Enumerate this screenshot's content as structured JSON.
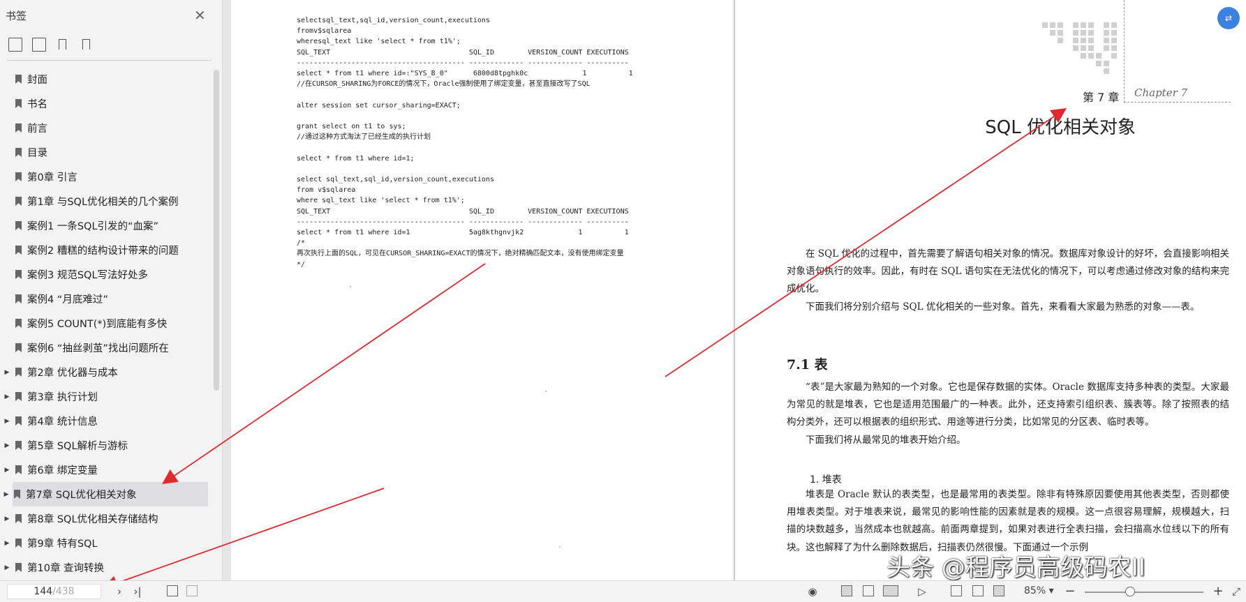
{
  "sidebar": {
    "title": "书签",
    "items": [
      {
        "label": "封面",
        "expandable": false
      },
      {
        "label": "书名",
        "expandable": false
      },
      {
        "label": "前言",
        "expandable": false
      },
      {
        "label": "目录",
        "expandable": false
      },
      {
        "label": "第0章 引言",
        "expandable": false
      },
      {
        "label": "第1章 与SQL优化相关的几个案例",
        "expandable": false
      },
      {
        "label": "案例1 一条SQL引发的“血案”",
        "expandable": false
      },
      {
        "label": "案例2 糟糕的结构设计带来的问题",
        "expandable": false
      },
      {
        "label": "案例3 规范SQL写法好处多",
        "expandable": false
      },
      {
        "label": "案例4 “月底难过”",
        "expandable": false
      },
      {
        "label": "案例5 COUNT(*)到底能有多快",
        "expandable": false
      },
      {
        "label": "案例6 “抽丝剥茧”找出问题所在",
        "expandable": false
      },
      {
        "label": "第2章 优化器与成本",
        "expandable": true
      },
      {
        "label": "第3章 执行计划",
        "expandable": true
      },
      {
        "label": "第4章 统计信息",
        "expandable": true
      },
      {
        "label": "第5章 SQL解析与游标",
        "expandable": true
      },
      {
        "label": "第6章 绑定变量",
        "expandable": true
      },
      {
        "label": "第7章 SQL优化相关对象",
        "expandable": true,
        "active": true
      },
      {
        "label": "第8章 SQL优化相关存储结构",
        "expandable": true
      },
      {
        "label": "第9章 特有SQL",
        "expandable": true
      },
      {
        "label": "第10章 查询转换",
        "expandable": true
      }
    ]
  },
  "left_page": {
    "code": "selectsql_text,sql_id,version_count,executions\nfromv$sqlarea\nwheresql_text like 'select * from t1%';\nSQL_TEXT                                 SQL_ID        VERSION_COUNT EXECUTIONS\n---------------------------------------- ------------- ------------- ----------\nselect * from t1 where id=:\"SYS_B_0\"      6800d8tpghk0c             1          1\n//在CURSOR_SHARING为FORCE的情况下，Oracle强制使用了绑定变量，甚至直接改写了SQL\n\nalter session set cursor_sharing=EXACT;\n\ngrant select on t1 to sys;\n//通过这种方式淘汰了已经生成的执行计划\n\nselect * from t1 where id=1;\n\nselect sql_text,sql_id,version_count,executions\nfrom v$sqlarea\nwhere sql_text like 'select * from t1%';\nSQL_TEXT                                 SQL_ID        VERSION_COUNT EXECUTIONS\n---------------------------------------- ------------- ------------- ----------\nselect * from t1 where id=1              5ag8kthgnvjk2             1          1\n/*\n再次执行上面的SQL，可见在CURSOR_SHARING=EXACT的情况下，绝对精确匹配文本，没有使用绑定变量\n*/"
  },
  "right_page": {
    "chapter_number": "第 7 章",
    "chapter_caption": "Chapter 7",
    "chapter_title": "SQL 优化相关对象",
    "intro": [
      "在 SQL 优化的过程中，首先需要了解语句相关对象的情况。数据库对象设计的好坏，会直接影响相关对象语句执行的效率。因此，有时在 SQL 语句实在无法优化的情况下，可以考虑通过修改对象的结构来完成优化。",
      "下面我们将分别介绍与 SQL 优化相关的一些对象。首先，来看看大家最为熟悉的对象——表。"
    ],
    "section_heading": "7.1   表",
    "section_paragraphs": [
      "“表”是大家最为熟知的一个对象。它也是保存数据的实体。Oracle 数据库支持多种表的类型。大家最为常见的就是堆表，它也是适用范围最广的一种表。此外，还支持索引组织表、簇表等。除了按照表的结构分类外，还可以根据表的组织形式、用途等进行分类，比如常见的分区表、临时表等。",
      "下面我们将从最常见的堆表开始介绍。"
    ],
    "subheading": "1. 堆表",
    "sub_paragraph": "堆表是 Oracle 默认的表类型，也是最常用的表类型。除非有特殊原因要使用其他表类型，否则都使用堆表类型。对于堆表来说，最常见的影响性能的因素就是表的规模。这一点很容易理解，规模越大，扫描的块数越多，当然成本也就越高。前面两章提到，如果对表进行全表扫描，会扫描高水位线以下的所有块。这也解释了为什么删除数据后，扫描表仍然很慢。下面通过一个示例"
  },
  "watermark": "头条 @程序员高级码农II",
  "toolbar": {
    "current_page": "144",
    "total_pages": "/438",
    "zoom": "85%",
    "zoom_level_fraction": 0.38
  },
  "colors": {
    "annotation_arrow": "#e0282e",
    "float_button": "#3b82e0",
    "active_bookmark_bg": "#dedee2"
  }
}
